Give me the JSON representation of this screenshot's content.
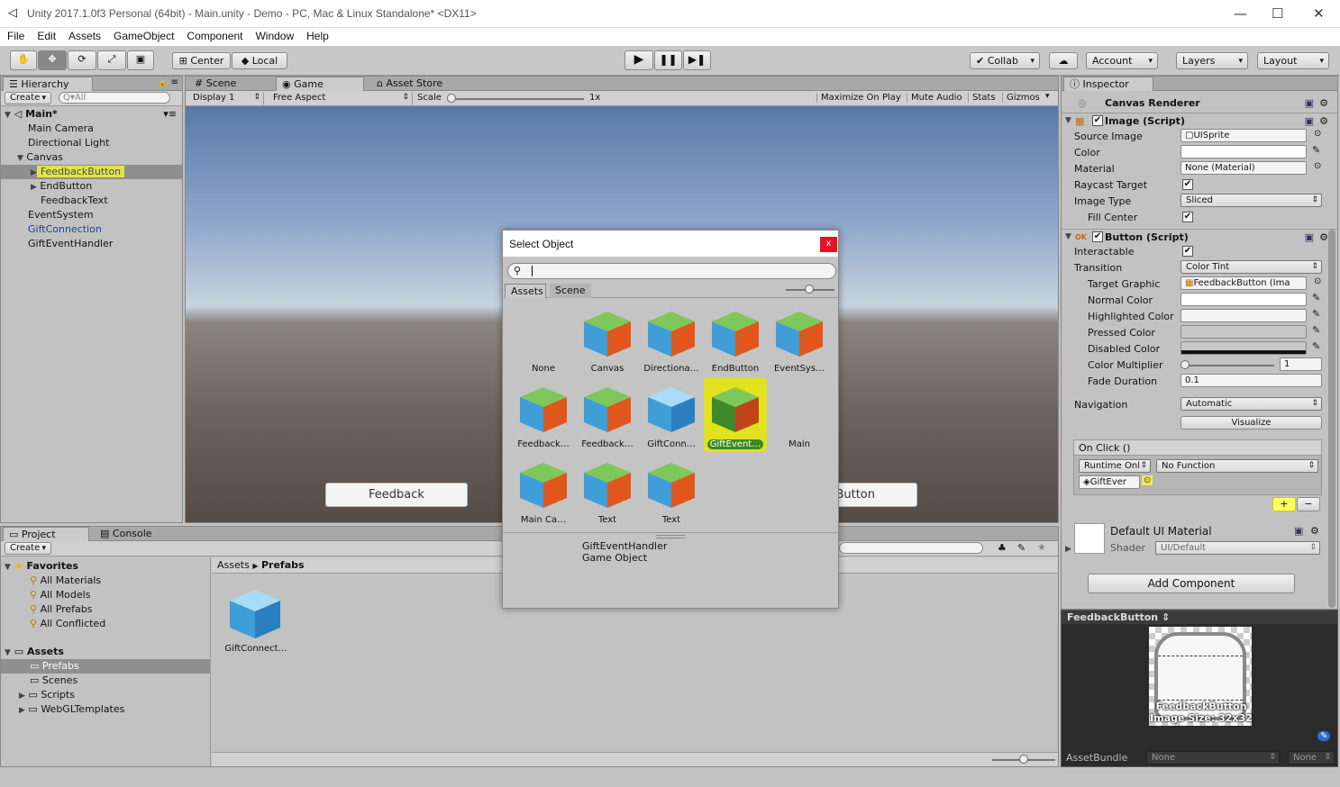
{
  "window": {
    "title": "Unity 2017.1.0f3 Personal (64bit) - Main.unity - Demo - PC, Mac & Linux Standalone* <DX11>"
  },
  "menu": [
    "File",
    "Edit",
    "Assets",
    "GameObject",
    "Component",
    "Window",
    "Help"
  ],
  "toolbar": {
    "center": "Center",
    "local": "Local",
    "collab": "Collab",
    "account": "Account",
    "layers": "Layers",
    "layout": "Layout"
  },
  "hierarchy": {
    "tab": "Hierarchy",
    "create": "Create",
    "search_placeholder": "Q▾All",
    "scene": "Main*",
    "items": [
      "Main Camera",
      "Directional Light",
      "Canvas",
      "FeedbackButton",
      "EndButton",
      "FeedbackText",
      "EventSystem",
      "GiftConnection",
      "GiftEventHandler"
    ]
  },
  "game": {
    "tabs": [
      "Scene",
      "Game",
      "Asset Store"
    ],
    "display": "Display 1",
    "aspect": "Free Aspect",
    "scale_label": "Scale",
    "scale_value": "1x",
    "options": [
      "Maximize On Play",
      "Mute Audio",
      "Stats",
      "Gizmos"
    ],
    "feedback_btn": "Feedback",
    "end_btn": "Button"
  },
  "dialog": {
    "title": "Select Object",
    "close": "x",
    "tabs": [
      "Assets",
      "Scene"
    ],
    "items": [
      "None",
      "Canvas",
      "Directiona…",
      "EndButton",
      "EventSys…",
      "Feedback…",
      "Feedback…",
      "GiftConn…",
      "GiftEvent…",
      "Main",
      "Main Ca…",
      "Text",
      "Text"
    ],
    "footer_name": "GiftEventHandler",
    "footer_type": "Game Object"
  },
  "project": {
    "tabs": [
      "Project",
      "Console"
    ],
    "create": "Create",
    "favorites": "Favorites",
    "fav_items": [
      "All Materials",
      "All Models",
      "All Prefabs",
      "All Conflicted"
    ],
    "assets": "Assets",
    "asset_items": [
      "Prefabs",
      "Scenes",
      "Scripts",
      "WebGLTemplates"
    ],
    "breadcrumb_root": "Assets",
    "breadcrumb_leaf": "Prefabs",
    "file": "GiftConnect…"
  },
  "inspector": {
    "tab": "Inspector",
    "canvas_renderer": "Canvas Renderer",
    "image": {
      "title": "Image (Script)",
      "rows": [
        {
          "label": "Source Image",
          "value": "UISprite"
        },
        {
          "label": "Color",
          "value": ""
        },
        {
          "label": "Material",
          "value": "None (Material)"
        },
        {
          "label": "Raycast Target",
          "value": "✔"
        },
        {
          "label": "Image Type",
          "value": "Sliced"
        },
        {
          "label": "Fill Center",
          "value": "✔"
        }
      ]
    },
    "button": {
      "title": "Button (Script)",
      "interactable": "Interactable",
      "transition": "Transition",
      "transition_value": "Color Tint",
      "target_graphic": "Target Graphic",
      "target_graphic_value": "FeedbackButton (Ima",
      "normal": "Normal Color",
      "highlighted": "Highlighted Color",
      "pressed": "Pressed Color",
      "disabled": "Disabled Color",
      "multiplier": "Color Multiplier",
      "multiplier_value": "1",
      "fade": "Fade Duration",
      "fade_value": "0.1",
      "navigation": "Navigation",
      "navigation_value": "Automatic",
      "visualize": "Visualize",
      "onclick": "On Click ()",
      "runtime": "Runtime Onl",
      "function": "No Function",
      "obj": "GiftEver",
      "plus": "+",
      "minus": "−"
    },
    "material": {
      "name": "Default UI Material",
      "shader_label": "Shader",
      "shader_value": "UI/Default"
    },
    "add_component": "Add Component",
    "preview": {
      "title": "FeedbackButton",
      "caption1": "FeedbackButton",
      "caption2": "Image Size: 32x32"
    },
    "assetbundle": {
      "label": "AssetBundle",
      "value1": "None",
      "value2": "None"
    }
  }
}
